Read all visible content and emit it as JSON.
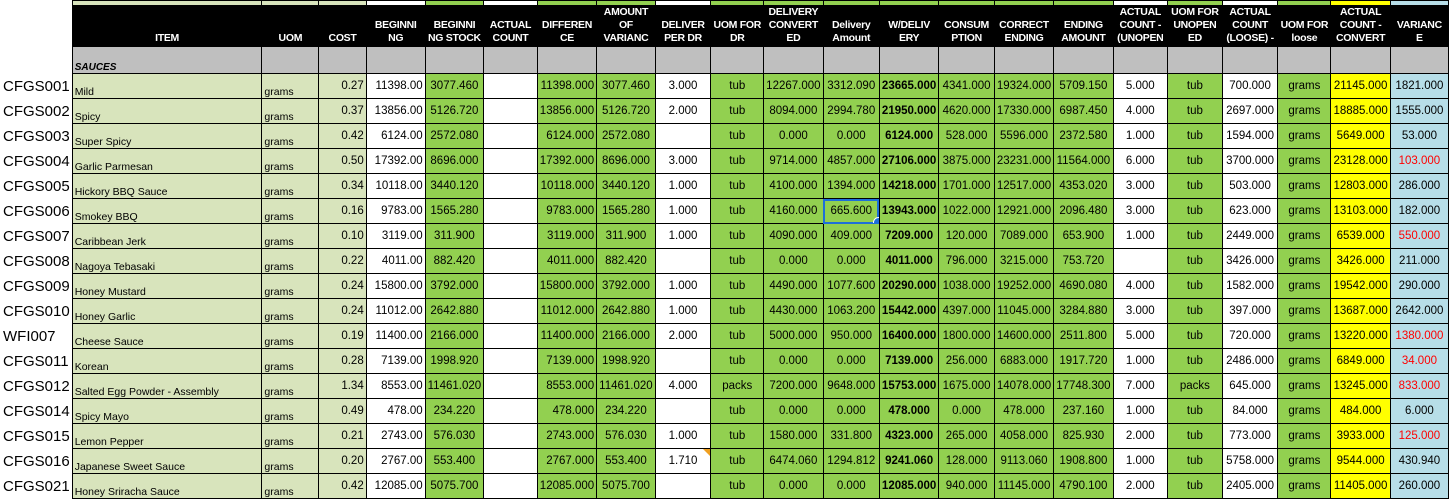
{
  "colors": {
    "header": "#000000",
    "section": "#bfbfbf",
    "green": "#92d050",
    "light_green": "#d8e4bc",
    "yellow": "#ffff00",
    "light_blue": "#b7dee8",
    "negative_text": "#ff0000",
    "selection": "#1e6fd9"
  },
  "headers": [
    "",
    "ITEM",
    "UOM",
    "COST",
    "BEGINNI NG",
    "BEGINNI NG STOCK",
    "ACTUAL COUNT",
    "DIFFEREN CE",
    "AMOUNT OF VARIANC",
    "DELIVER PER DR",
    "UOM FOR DR",
    "DELIVERY CONVERT ED",
    "Delivery Amount",
    "W/DELIV ERY",
    "CONSUM PTION",
    "CORRECT ENDING",
    "ENDING AMOUNT",
    "ACTUAL COUNT - (UNOPEN",
    "UOM FOR UNOPEN ED",
    "ACTUAL COUNT (LOOSE) -",
    "UOM FOR loose",
    "ACTUAL COUNT - CONVERT",
    "VARIANC E"
  ],
  "section": "SAUCES",
  "selected_cell": {
    "row": 5,
    "column": "Delivery Amount"
  },
  "rows": [
    {
      "cells": [
        "CFGS001",
        "Mild",
        "grams",
        "0.27",
        "11398.00",
        "3077.460",
        "",
        "11398.000",
        "3077.460",
        "3.000",
        "tub",
        "12267.000",
        "3312.090",
        "23665.000",
        "4341.000",
        "19324.000",
        "5709.150",
        "5.000",
        "tub",
        "700.000",
        "grams",
        "21145.000",
        "1821.000"
      ],
      "variance_negative": false
    },
    {
      "cells": [
        "CFGS002",
        "Spicy",
        "grams",
        "0.37",
        "13856.00",
        "5126.720",
        "",
        "13856.000",
        "5126.720",
        "2.000",
        "tub",
        "8094.000",
        "2994.780",
        "21950.000",
        "4620.000",
        "17330.000",
        "6987.450",
        "4.000",
        "tub",
        "2697.000",
        "grams",
        "18885.000",
        "1555.000"
      ],
      "variance_negative": false
    },
    {
      "cells": [
        "CFGS003",
        "Super Spicy",
        "grams",
        "0.42",
        "6124.00",
        "2572.080",
        "",
        "6124.000",
        "2572.080",
        "",
        "tub",
        "0.000",
        "0.000",
        "6124.000",
        "528.000",
        "5596.000",
        "2372.580",
        "1.000",
        "tub",
        "1594.000",
        "grams",
        "5649.000",
        "53.000"
      ],
      "variance_negative": false
    },
    {
      "cells": [
        "CFGS004",
        "Garlic Parmesan",
        "grams",
        "0.50",
        "17392.00",
        "8696.000",
        "",
        "17392.000",
        "8696.000",
        "3.000",
        "tub",
        "9714.000",
        "4857.000",
        "27106.000",
        "3875.000",
        "23231.000",
        "11564.000",
        "6.000",
        "tub",
        "3700.000",
        "grams",
        "23128.000",
        "103.000"
      ],
      "variance_negative": true
    },
    {
      "cells": [
        "CFGS005",
        "Hickory BBQ Sauce",
        "grams",
        "0.34",
        "10118.00",
        "3440.120",
        "",
        "10118.000",
        "3440.120",
        "1.000",
        "tub",
        "4100.000",
        "1394.000",
        "14218.000",
        "1701.000",
        "12517.000",
        "4353.020",
        "3.000",
        "tub",
        "503.000",
        "grams",
        "12803.000",
        "286.000"
      ],
      "variance_negative": false
    },
    {
      "cells": [
        "CFGS006",
        "Smokey BBQ",
        "grams",
        "0.16",
        "9783.00",
        "1565.280",
        "",
        "9783.000",
        "1565.280",
        "1.000",
        "tub",
        "4160.000",
        "665.600",
        "13943.000",
        "1022.000",
        "12921.000",
        "2096.480",
        "3.000",
        "tub",
        "623.000",
        "grams",
        "13103.000",
        "182.000"
      ],
      "variance_negative": false
    },
    {
      "cells": [
        "CFGS007",
        "Caribbean Jerk",
        "grams",
        "0.10",
        "3119.00",
        "311.900",
        "",
        "3119.000",
        "311.900",
        "1.000",
        "tub",
        "4090.000",
        "409.000",
        "7209.000",
        "120.000",
        "7089.000",
        "653.900",
        "1.000",
        "tub",
        "2449.000",
        "grams",
        "6539.000",
        "550.000"
      ],
      "variance_negative": true
    },
    {
      "cells": [
        "CFGS008",
        "Nagoya Tebasaki",
        "grams",
        "0.22",
        "4011.00",
        "882.420",
        "",
        "4011.000",
        "882.420",
        "",
        "tub",
        "0.000",
        "0.000",
        "4011.000",
        "796.000",
        "3215.000",
        "753.720",
        "",
        "tub",
        "3426.000",
        "grams",
        "3426.000",
        "211.000"
      ],
      "variance_negative": false
    },
    {
      "cells": [
        "CFGS009",
        "Honey Mustard",
        "grams",
        "0.24",
        "15800.00",
        "3792.000",
        "",
        "15800.000",
        "3792.000",
        "1.000",
        "tub",
        "4490.000",
        "1077.600",
        "20290.000",
        "1038.000",
        "19252.000",
        "4690.080",
        "4.000",
        "tub",
        "1582.000",
        "grams",
        "19542.000",
        "290.000"
      ],
      "variance_negative": false
    },
    {
      "cells": [
        "CFGS010",
        "Honey Garlic",
        "grams",
        "0.24",
        "11012.00",
        "2642.880",
        "",
        "11012.000",
        "2642.880",
        "1.000",
        "tub",
        "4430.000",
        "1063.200",
        "15442.000",
        "4397.000",
        "11045.000",
        "3284.880",
        "3.000",
        "tub",
        "397.000",
        "grams",
        "13687.000",
        "2642.000"
      ],
      "variance_negative": false
    },
    {
      "cells": [
        "WFI007",
        "Cheese Sauce",
        "grams",
        "0.19",
        "11400.00",
        "2166.000",
        "",
        "11400.000",
        "2166.000",
        "2.000",
        "tub",
        "5000.000",
        "950.000",
        "16400.000",
        "1800.000",
        "14600.000",
        "2511.800",
        "5.000",
        "tub",
        "720.000",
        "grams",
        "13220.000",
        "1380.000"
      ],
      "variance_negative": true
    },
    {
      "cells": [
        "CFGS011",
        "Korean",
        "grams",
        "0.28",
        "7139.00",
        "1998.920",
        "",
        "7139.000",
        "1998.920",
        "",
        "tub",
        "0.000",
        "0.000",
        "7139.000",
        "256.000",
        "6883.000",
        "1917.720",
        "1.000",
        "tub",
        "2486.000",
        "grams",
        "6849.000",
        "34.000"
      ],
      "variance_negative": true
    },
    {
      "cells": [
        "CFGS012",
        "Salted Egg Powder - Assembly",
        "grams",
        "1.34",
        "8553.00",
        "11461.020",
        "",
        "8553.000",
        "11461.020",
        "4.000",
        "packs",
        "7200.000",
        "9648.000",
        "15753.000",
        "1675.000",
        "14078.000",
        "17748.300",
        "7.000",
        "packs",
        "645.000",
        "grams",
        "13245.000",
        "833.000"
      ],
      "variance_negative": true
    },
    {
      "cells": [
        "CFGS014",
        "Spicy Mayo",
        "grams",
        "0.49",
        "478.00",
        "234.220",
        "",
        "478.000",
        "234.220",
        "",
        "tub",
        "0.000",
        "0.000",
        "478.000",
        "0.000",
        "478.000",
        "237.160",
        "1.000",
        "tub",
        "84.000",
        "grams",
        "484.000",
        "6.000"
      ],
      "variance_negative": false
    },
    {
      "cells": [
        "CFGS015",
        "Lemon Pepper",
        "grams",
        "0.21",
        "2743.00",
        "576.030",
        "",
        "2743.000",
        "576.030",
        "1.000",
        "tub",
        "1580.000",
        "331.800",
        "4323.000",
        "265.000",
        "4058.000",
        "825.930",
        "2.000",
        "tub",
        "773.000",
        "grams",
        "3933.000",
        "125.000"
      ],
      "variance_negative": true
    },
    {
      "cells": [
        "CFGS016",
        "Japanese Sweet Sauce",
        "grams",
        "0.20",
        "2767.00",
        "553.400",
        "",
        "2767.000",
        "553.400",
        "1.710",
        "tub",
        "6474.060",
        "1294.812",
        "9241.060",
        "128.000",
        "9113.060",
        "1908.800",
        "1.000",
        "tub",
        "5758.000",
        "grams",
        "9544.000",
        "430.940"
      ],
      "variance_negative": false,
      "comment_on": "DELIVER PER DR"
    },
    {
      "cells": [
        "CFGS021",
        "Honey Sriracha Sauce",
        "grams",
        "0.42",
        "12085.00",
        "5075.700",
        "",
        "12085.000",
        "5075.700",
        "",
        "tub",
        "0.000",
        "0.000",
        "12085.000",
        "940.000",
        "11145.000",
        "4790.100",
        "2.000",
        "tub",
        "2405.000",
        "grams",
        "11405.000",
        "260.000"
      ],
      "variance_negative": false
    }
  ]
}
